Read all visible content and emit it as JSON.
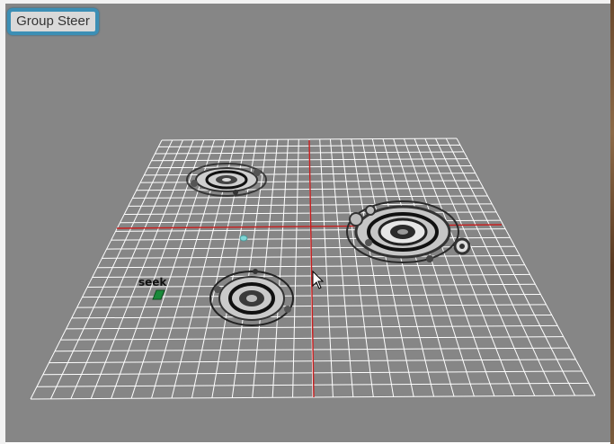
{
  "toolbar": {
    "group_steer_label": "Group Steer"
  },
  "scene": {
    "agent_label": "seek",
    "ground_color": "#ffffff",
    "background_color": "#868686",
    "axis_color": "#c81e1e",
    "agent_color": "#1a8a3a",
    "target_color": "#7fd6d6"
  }
}
